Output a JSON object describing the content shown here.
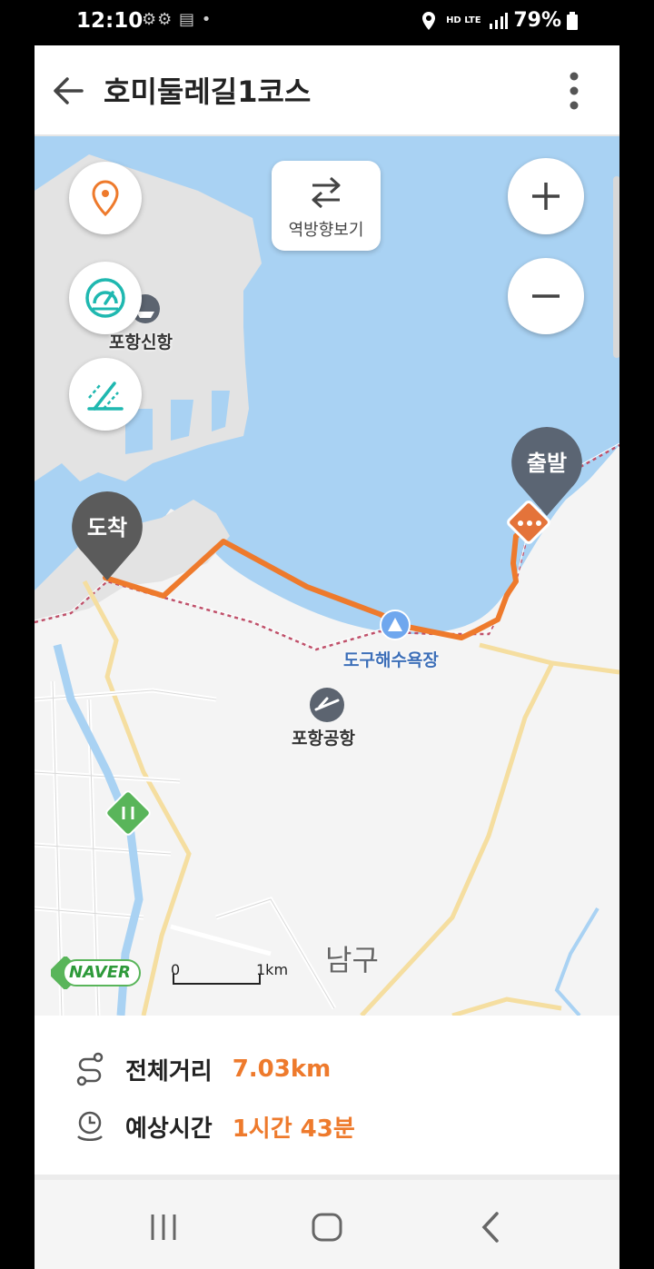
{
  "status_bar": {
    "time": "12:10",
    "network": "HD LTE",
    "battery": "79%"
  },
  "header": {
    "title": "호미둘레길1코스"
  },
  "map": {
    "reverse_button_label": "역방향보기",
    "start_label": "출발",
    "end_label": "도착",
    "places": {
      "port": "포항신항",
      "beach": "도구해수욕장",
      "airport": "포항공항",
      "district": "남구"
    },
    "scale": {
      "zero": "0",
      "distance": "1km"
    },
    "logo": "NAVER"
  },
  "info": {
    "distance_label": "전체거리",
    "distance_value": "7.03km",
    "time_label": "예상시간",
    "time_value": "1시간 43분"
  },
  "colors": {
    "route": "#ee7a2c",
    "water": "#a9d2f3",
    "accent": "#ee7a2c",
    "teal": "#1fb8b0"
  }
}
